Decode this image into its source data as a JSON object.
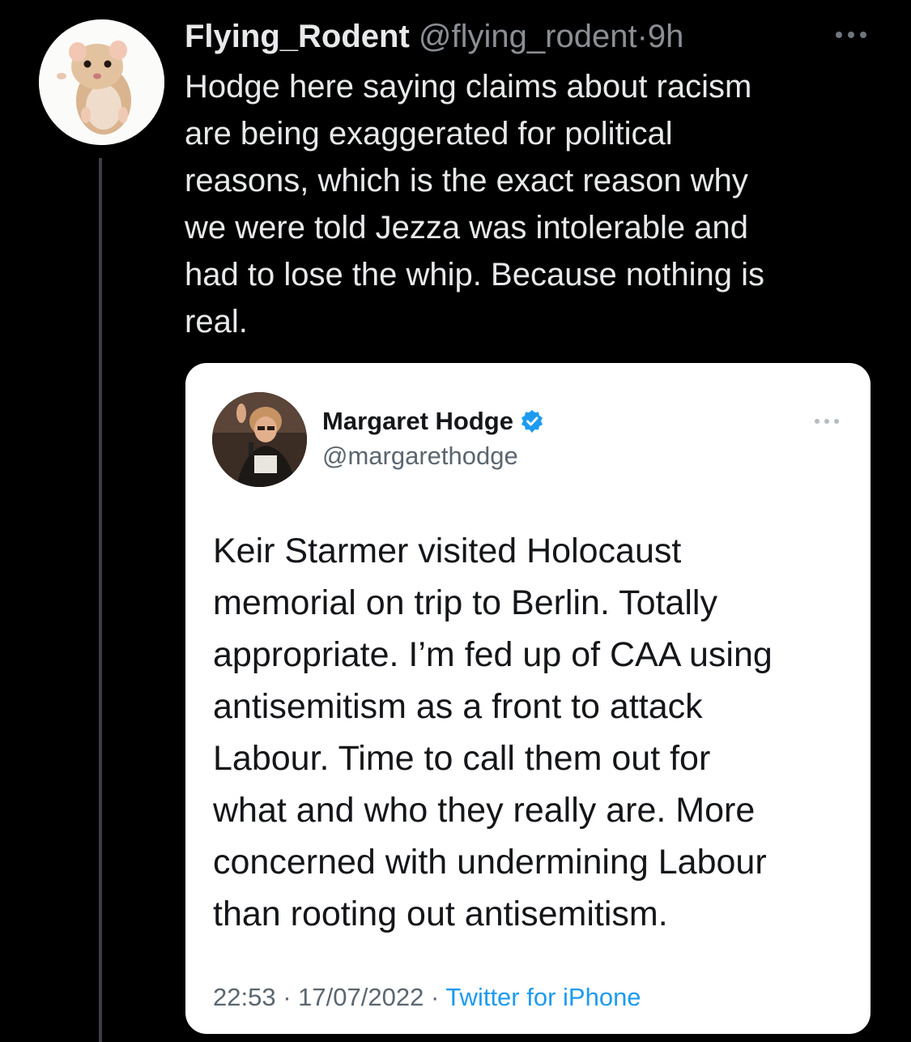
{
  "tweet": {
    "display_name": "Flying_Rodent",
    "handle": "@flying_rodent",
    "separator": "·",
    "time": "9h",
    "text": "Hodge here saying claims about racism\nare being exaggerated for political\nreasons, which is the exact reason why\nwe were told Jezza was intolerable and\nhad to lose the whip. Because nothing is\nreal.",
    "avatar_icon": "hamster-avatar",
    "more_icon": "more-options-icon"
  },
  "quote": {
    "display_name": "Margaret Hodge",
    "verified_icon": "verified-badge-icon",
    "handle": "@margarethodge",
    "text": "Keir Starmer visited Holocaust\nmemorial on trip to Berlin. Totally\nappropriate. I’m fed up of CAA using\nantisemitism as a front to attack\nLabour. Time to call them out for\nwhat and who they really are. More\nconcerned with undermining Labour\nthan rooting out antisemitism.",
    "time": "22:53",
    "separator": "·",
    "date": "17/07/2022",
    "source": "Twitter for iPhone",
    "more_icon": "more-options-icon"
  },
  "colors": {
    "background": "#000000",
    "primary_text": "#e7e9ea",
    "secondary_text": "#8b8f94",
    "card_background": "#ffffff",
    "card_text": "#141619",
    "card_secondary": "#5b6670",
    "link": "#1d9bf0",
    "verified": "#1d9bf0"
  }
}
